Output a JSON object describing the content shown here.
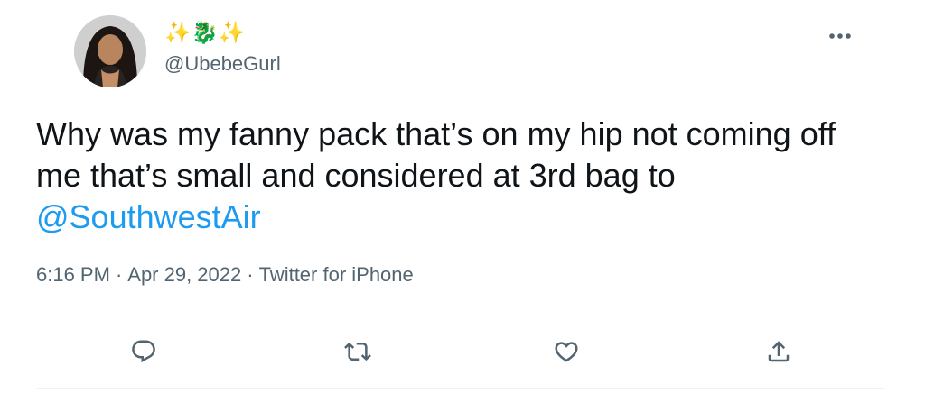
{
  "author": {
    "display_name": "✨🐉✨",
    "handle": "@UbebeGurl",
    "avatar_icon": "user-avatar"
  },
  "tweet": {
    "text_before": "Why was my fanny pack that’s on my hip not coming off me that’s small and considered at 3rd bag to ",
    "mention": "@SouthwestAir",
    "time": "6:16 PM",
    "separator": "·",
    "date": "Apr 29, 2022",
    "source": "Twitter for iPhone"
  },
  "actions": {
    "reply_icon": "reply-icon",
    "retweet_icon": "retweet-icon",
    "like_icon": "like-icon",
    "share_icon": "share-icon",
    "more_icon": "more-options-icon"
  },
  "colors": {
    "text": "#0f1419",
    "secondary": "#536471",
    "link": "#1d9bf0",
    "divider": "#eff3f4"
  }
}
